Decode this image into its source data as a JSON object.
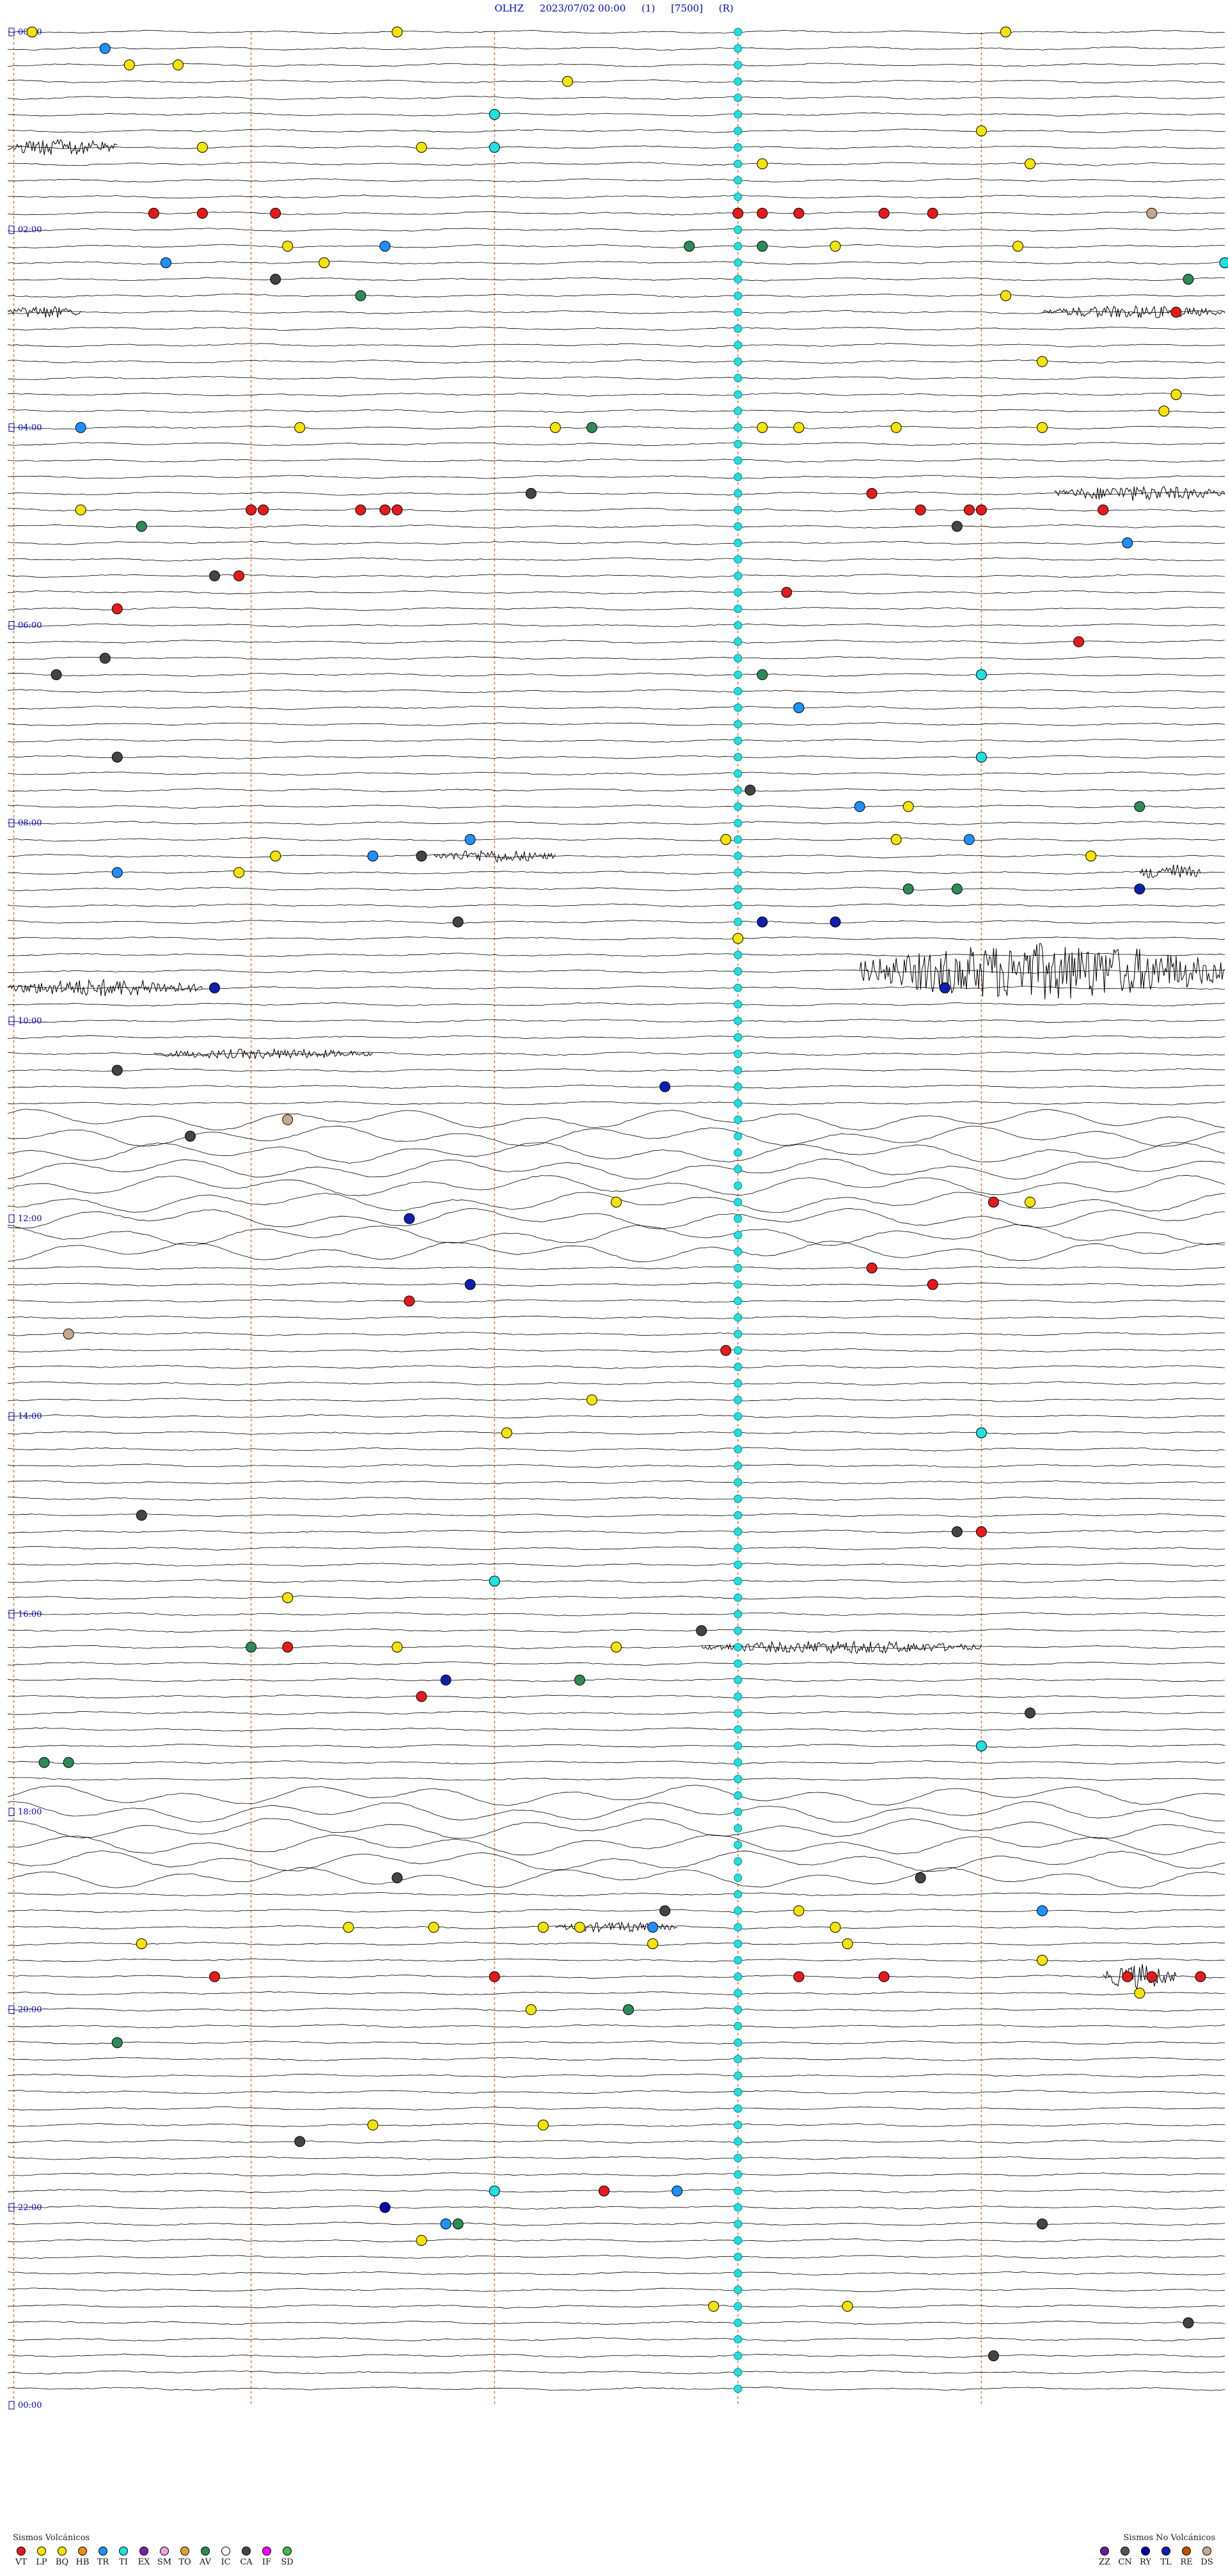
{
  "header": {
    "station": "OLHZ",
    "date_time": "2023/07/02 00:00",
    "channel": "(1)",
    "scale": "[7500]",
    "mode": "(R)"
  },
  "chart_data": {
    "type": "helicorder",
    "title": "OLHZ 2023/07/02 00:00 (1) [7500] (R)",
    "hour_labels": [
      "00:00",
      "02:00",
      "04:00",
      "06:00",
      "08:00",
      "10:00",
      "12:00",
      "14:00",
      "16:00",
      "18:00",
      "20:00",
      "22:00",
      "00:00"
    ],
    "hours": [
      0,
      2,
      4,
      6,
      8,
      10,
      12,
      14,
      16,
      18,
      20,
      22,
      24
    ],
    "trace_count": 144,
    "minutes_per_trace": 10,
    "trace_color": "#000000",
    "label_color": "#0000cc",
    "dashed_marker_color": "#e07a3c",
    "dashed_marker_positions": [
      0.005,
      0.2,
      0.4,
      0.6,
      0.8
    ],
    "cyan_ti_column": 0.6,
    "noisy_trace_ranges": [
      [
        66,
        74
      ],
      [
        107,
        112
      ]
    ],
    "burst_traces": [
      {
        "trace": 7,
        "x0": 0.0,
        "x1": 0.09,
        "amp": 14
      },
      {
        "trace": 17,
        "x0": 0.0,
        "x1": 0.06,
        "amp": 10
      },
      {
        "trace": 17,
        "x0": 0.85,
        "x1": 1.0,
        "amp": 10
      },
      {
        "trace": 28,
        "x0": 0.86,
        "x1": 1.0,
        "amp": 12
      },
      {
        "trace": 50,
        "x0": 0.35,
        "x1": 0.45,
        "amp": 10
      },
      {
        "trace": 51,
        "x0": 0.93,
        "x1": 0.98,
        "amp": 14
      },
      {
        "trace": 57,
        "x0": 0.7,
        "x1": 1.0,
        "amp": 45
      },
      {
        "trace": 58,
        "x0": 0.0,
        "x1": 0.16,
        "amp": 14
      },
      {
        "trace": 62,
        "x0": 0.12,
        "x1": 0.3,
        "amp": 8
      },
      {
        "trace": 98,
        "x0": 0.57,
        "x1": 0.8,
        "amp": 10
      },
      {
        "trace": 115,
        "x0": 0.45,
        "x1": 0.55,
        "amp": 8
      },
      {
        "trace": 118,
        "x0": 0.9,
        "x1": 0.96,
        "amp": 20
      }
    ],
    "event_types": [
      {
        "code": "VT",
        "color": "#e41a1c"
      },
      {
        "code": "LP",
        "color": "#f5e400"
      },
      {
        "code": "BQ",
        "color": "#f5e400"
      },
      {
        "code": "HB",
        "color": "#f08a1e"
      },
      {
        "code": "TR",
        "color": "#1e90ff"
      },
      {
        "code": "TI",
        "color": "#20e0e0"
      },
      {
        "code": "EX",
        "color": "#7b1fa2"
      },
      {
        "code": "SM",
        "color": "#f0a0e0"
      },
      {
        "code": "TO",
        "color": "#e0a030"
      },
      {
        "code": "AV",
        "color": "#2e8b57"
      },
      {
        "code": "IC",
        "color": "#ffffff"
      },
      {
        "code": "CA",
        "color": "#444444"
      },
      {
        "code": "IF",
        "color": "#ff00ff"
      },
      {
        "code": "SD",
        "color": "#44bb44"
      }
    ],
    "non_volcanic_types": [
      {
        "code": "ZZ",
        "color": "#6a1b9a"
      },
      {
        "code": "CN",
        "color": "#555555"
      },
      {
        "code": "RY",
        "color": "#0000aa"
      },
      {
        "code": "TL",
        "color": "#0d1fb0"
      },
      {
        "code": "RE",
        "color": "#c05000"
      },
      {
        "code": "DS",
        "color": "#c8a88a"
      }
    ],
    "events": [
      {
        "trace": 0,
        "x": 0.02,
        "type": "LP"
      },
      {
        "trace": 0,
        "x": 0.32,
        "type": "LP"
      },
      {
        "trace": 0,
        "x": 0.82,
        "type": "LP"
      },
      {
        "trace": 1,
        "x": 0.08,
        "type": "TR"
      },
      {
        "trace": 2,
        "x": 0.1,
        "type": "LP"
      },
      {
        "trace": 2,
        "x": 0.14,
        "type": "LP"
      },
      {
        "trace": 3,
        "x": 0.46,
        "type": "LP"
      },
      {
        "trace": 5,
        "x": 0.4,
        "type": "TI"
      },
      {
        "trace": 6,
        "x": 0.8,
        "type": "LP"
      },
      {
        "trace": 7,
        "x": 0.16,
        "type": "LP"
      },
      {
        "trace": 7,
        "x": 0.34,
        "type": "LP"
      },
      {
        "trace": 7,
        "x": 0.4,
        "type": "TI"
      },
      {
        "trace": 8,
        "x": 0.62,
        "type": "LP"
      },
      {
        "trace": 8,
        "x": 0.84,
        "type": "LP"
      },
      {
        "trace": 11,
        "x": 0.12,
        "type": "VT"
      },
      {
        "trace": 11,
        "x": 0.16,
        "type": "VT"
      },
      {
        "trace": 11,
        "x": 0.22,
        "type": "VT"
      },
      {
        "trace": 11,
        "x": 0.6,
        "type": "VT"
      },
      {
        "trace": 11,
        "x": 0.62,
        "type": "VT"
      },
      {
        "trace": 11,
        "x": 0.65,
        "type": "VT"
      },
      {
        "trace": 11,
        "x": 0.72,
        "type": "VT"
      },
      {
        "trace": 11,
        "x": 0.76,
        "type": "VT"
      },
      {
        "trace": 11,
        "x": 0.94,
        "type": "DS"
      },
      {
        "trace": 13,
        "x": 0.23,
        "type": "LP"
      },
      {
        "trace": 13,
        "x": 0.31,
        "type": "TR"
      },
      {
        "trace": 13,
        "x": 0.56,
        "type": "AV"
      },
      {
        "trace": 13,
        "x": 0.62,
        "type": "AV"
      },
      {
        "trace": 13,
        "x": 0.68,
        "type": "LP"
      },
      {
        "trace": 13,
        "x": 0.83,
        "type": "LP"
      },
      {
        "trace": 14,
        "x": 0.13,
        "type": "TR"
      },
      {
        "trace": 14,
        "x": 0.26,
        "type": "LP"
      },
      {
        "trace": 14,
        "x": 1.0,
        "type": "TI"
      },
      {
        "trace": 15,
        "x": 0.22,
        "type": "CA"
      },
      {
        "trace": 15,
        "x": 0.97,
        "type": "AV"
      },
      {
        "trace": 16,
        "x": 0.29,
        "type": "AV"
      },
      {
        "trace": 16,
        "x": 0.82,
        "type": "LP"
      },
      {
        "trace": 17,
        "x": 0.96,
        "type": "VT"
      },
      {
        "trace": 20,
        "x": 0.85,
        "type": "LP"
      },
      {
        "trace": 22,
        "x": 0.96,
        "type": "LP"
      },
      {
        "trace": 23,
        "x": 0.95,
        "type": "LP"
      },
      {
        "trace": 24,
        "x": 0.06,
        "type": "TR"
      },
      {
        "trace": 24,
        "x": 0.24,
        "type": "LP"
      },
      {
        "trace": 24,
        "x": 0.45,
        "type": "LP"
      },
      {
        "trace": 24,
        "x": 0.48,
        "type": "AV"
      },
      {
        "trace": 24,
        "x": 0.62,
        "type": "LP"
      },
      {
        "trace": 24,
        "x": 0.65,
        "type": "LP"
      },
      {
        "trace": 24,
        "x": 0.73,
        "type": "LP"
      },
      {
        "trace": 24,
        "x": 0.85,
        "type": "LP"
      },
      {
        "trace": 28,
        "x": 0.43,
        "type": "CA"
      },
      {
        "trace": 28,
        "x": 0.71,
        "type": "VT"
      },
      {
        "trace": 29,
        "x": 0.06,
        "type": "LP"
      },
      {
        "trace": 29,
        "x": 0.2,
        "type": "VT"
      },
      {
        "trace": 29,
        "x": 0.21,
        "type": "VT"
      },
      {
        "trace": 29,
        "x": 0.29,
        "type": "VT"
      },
      {
        "trace": 29,
        "x": 0.31,
        "type": "VT"
      },
      {
        "trace": 29,
        "x": 0.32,
        "type": "VT"
      },
      {
        "trace": 29,
        "x": 0.75,
        "type": "VT"
      },
      {
        "trace": 29,
        "x": 0.79,
        "type": "VT"
      },
      {
        "trace": 29,
        "x": 0.8,
        "type": "VT"
      },
      {
        "trace": 29,
        "x": 0.9,
        "type": "VT"
      },
      {
        "trace": 30,
        "x": 0.11,
        "type": "AV"
      },
      {
        "trace": 30,
        "x": 0.78,
        "type": "CA"
      },
      {
        "trace": 31,
        "x": 0.92,
        "type": "TR"
      },
      {
        "trace": 33,
        "x": 0.17,
        "type": "CA"
      },
      {
        "trace": 33,
        "x": 0.19,
        "type": "VT"
      },
      {
        "trace": 34,
        "x": 0.64,
        "type": "VT"
      },
      {
        "trace": 35,
        "x": 0.09,
        "type": "VT"
      },
      {
        "trace": 37,
        "x": 0.88,
        "type": "VT"
      },
      {
        "trace": 38,
        "x": 0.08,
        "type": "CA"
      },
      {
        "trace": 39,
        "x": 0.04,
        "type": "CA"
      },
      {
        "trace": 39,
        "x": 0.62,
        "type": "AV"
      },
      {
        "trace": 39,
        "x": 0.8,
        "type": "TI"
      },
      {
        "trace": 41,
        "x": 0.65,
        "type": "TR"
      },
      {
        "trace": 44,
        "x": 0.09,
        "type": "CA"
      },
      {
        "trace": 44,
        "x": 0.8,
        "type": "TI"
      },
      {
        "trace": 46,
        "x": 0.61,
        "type": "CA"
      },
      {
        "trace": 47,
        "x": 0.74,
        "type": "LP"
      },
      {
        "trace": 47,
        "x": 0.93,
        "type": "AV"
      },
      {
        "trace": 47,
        "x": 0.7,
        "type": "TR"
      },
      {
        "trace": 49,
        "x": 0.38,
        "type": "TR"
      },
      {
        "trace": 49,
        "x": 0.59,
        "type": "LP"
      },
      {
        "trace": 49,
        "x": 0.73,
        "type": "LP"
      },
      {
        "trace": 49,
        "x": 0.79,
        "type": "TR"
      },
      {
        "trace": 50,
        "x": 0.22,
        "type": "LP"
      },
      {
        "trace": 50,
        "x": 0.3,
        "type": "TR"
      },
      {
        "trace": 50,
        "x": 0.34,
        "type": "CA"
      },
      {
        "trace": 50,
        "x": 0.89,
        "type": "LP"
      },
      {
        "trace": 51,
        "x": 0.09,
        "type": "TR"
      },
      {
        "trace": 51,
        "x": 0.19,
        "type": "LP"
      },
      {
        "trace": 52,
        "x": 0.74,
        "type": "AV"
      },
      {
        "trace": 52,
        "x": 0.78,
        "type": "AV"
      },
      {
        "trace": 52,
        "x": 0.93,
        "type": "TL"
      },
      {
        "trace": 54,
        "x": 0.37,
        "type": "CA"
      },
      {
        "trace": 54,
        "x": 0.62,
        "type": "TL"
      },
      {
        "trace": 54,
        "x": 0.68,
        "type": "TL"
      },
      {
        "trace": 55,
        "x": 0.6,
        "type": "LP"
      },
      {
        "trace": 58,
        "x": 0.17,
        "type": "TL"
      },
      {
        "trace": 58,
        "x": 0.77,
        "type": "TL"
      },
      {
        "trace": 63,
        "x": 0.09,
        "type": "CA"
      },
      {
        "trace": 64,
        "x": 0.54,
        "type": "TL"
      },
      {
        "trace": 66,
        "x": 0.23,
        "type": "DS"
      },
      {
        "trace": 67,
        "x": 0.15,
        "type": "CA"
      },
      {
        "trace": 71,
        "x": 0.5,
        "type": "LP"
      },
      {
        "trace": 71,
        "x": 0.81,
        "type": "VT"
      },
      {
        "trace": 71,
        "x": 0.84,
        "type": "LP"
      },
      {
        "trace": 72,
        "x": 0.33,
        "type": "TL"
      },
      {
        "trace": 75,
        "x": 0.71,
        "type": "VT"
      },
      {
        "trace": 76,
        "x": 0.38,
        "type": "TL"
      },
      {
        "trace": 76,
        "x": 0.76,
        "type": "VT"
      },
      {
        "trace": 77,
        "x": 0.33,
        "type": "VT"
      },
      {
        "trace": 79,
        "x": 0.05,
        "type": "DS"
      },
      {
        "trace": 80,
        "x": 0.59,
        "type": "VT"
      },
      {
        "trace": 83,
        "x": 0.48,
        "type": "LP"
      },
      {
        "trace": 85,
        "x": 0.41,
        "type": "LP"
      },
      {
        "trace": 85,
        "x": 0.8,
        "type": "TI"
      },
      {
        "trace": 90,
        "x": 0.11,
        "type": "CA"
      },
      {
        "trace": 91,
        "x": 0.78,
        "type": "CA"
      },
      {
        "trace": 91,
        "x": 0.8,
        "type": "VT"
      },
      {
        "trace": 94,
        "x": 0.4,
        "type": "TI"
      },
      {
        "trace": 95,
        "x": 0.23,
        "type": "LP"
      },
      {
        "trace": 97,
        "x": 0.57,
        "type": "CA"
      },
      {
        "trace": 98,
        "x": 0.2,
        "type": "AV"
      },
      {
        "trace": 98,
        "x": 0.23,
        "type": "VT"
      },
      {
        "trace": 98,
        "x": 0.32,
        "type": "LP"
      },
      {
        "trace": 98,
        "x": 0.5,
        "type": "LP"
      },
      {
        "trace": 100,
        "x": 0.36,
        "type": "TL"
      },
      {
        "trace": 100,
        "x": 0.47,
        "type": "AV"
      },
      {
        "trace": 101,
        "x": 0.34,
        "type": "VT"
      },
      {
        "trace": 102,
        "x": 0.84,
        "type": "CA"
      },
      {
        "trace": 104,
        "x": 0.8,
        "type": "TI"
      },
      {
        "trace": 105,
        "x": 0.03,
        "type": "AV"
      },
      {
        "trace": 105,
        "x": 0.05,
        "type": "AV"
      },
      {
        "trace": 112,
        "x": 0.32,
        "type": "CA"
      },
      {
        "trace": 112,
        "x": 0.75,
        "type": "CA"
      },
      {
        "trace": 114,
        "x": 0.54,
        "type": "CA"
      },
      {
        "trace": 114,
        "x": 0.65,
        "type": "LP"
      },
      {
        "trace": 114,
        "x": 0.85,
        "type": "TR"
      },
      {
        "trace": 115,
        "x": 0.28,
        "type": "LP"
      },
      {
        "trace": 115,
        "x": 0.35,
        "type": "LP"
      },
      {
        "trace": 115,
        "x": 0.44,
        "type": "LP"
      },
      {
        "trace": 115,
        "x": 0.47,
        "type": "LP"
      },
      {
        "trace": 115,
        "x": 0.53,
        "type": "TR"
      },
      {
        "trace": 115,
        "x": 0.68,
        "type": "LP"
      },
      {
        "trace": 116,
        "x": 0.11,
        "type": "LP"
      },
      {
        "trace": 116,
        "x": 0.53,
        "type": "LP"
      },
      {
        "trace": 116,
        "x": 0.69,
        "type": "LP"
      },
      {
        "trace": 117,
        "x": 0.85,
        "type": "LP"
      },
      {
        "trace": 118,
        "x": 0.17,
        "type": "VT"
      },
      {
        "trace": 118,
        "x": 0.65,
        "type": "VT"
      },
      {
        "trace": 118,
        "x": 0.72,
        "type": "VT"
      },
      {
        "trace": 118,
        "x": 0.92,
        "type": "VT"
      },
      {
        "trace": 118,
        "x": 0.94,
        "type": "VT"
      },
      {
        "trace": 118,
        "x": 0.98,
        "type": "VT"
      },
      {
        "trace": 118,
        "x": 0.4,
        "type": "VT"
      },
      {
        "trace": 119,
        "x": 0.93,
        "type": "LP"
      },
      {
        "trace": 120,
        "x": 0.43,
        "type": "LP"
      },
      {
        "trace": 120,
        "x": 0.51,
        "type": "AV"
      },
      {
        "trace": 122,
        "x": 0.09,
        "type": "AV"
      },
      {
        "trace": 127,
        "x": 0.3,
        "type": "LP"
      },
      {
        "trace": 127,
        "x": 0.44,
        "type": "LP"
      },
      {
        "trace": 128,
        "x": 0.24,
        "type": "CA"
      },
      {
        "trace": 131,
        "x": 0.4,
        "type": "TI"
      },
      {
        "trace": 131,
        "x": 0.49,
        "type": "VT"
      },
      {
        "trace": 131,
        "x": 0.55,
        "type": "TR"
      },
      {
        "trace": 132,
        "x": 0.31,
        "type": "RY"
      },
      {
        "trace": 133,
        "x": 0.36,
        "type": "TR"
      },
      {
        "trace": 133,
        "x": 0.37,
        "type": "AV"
      },
      {
        "trace": 133,
        "x": 0.85,
        "type": "CA"
      },
      {
        "trace": 134,
        "x": 0.34,
        "type": "LP"
      },
      {
        "trace": 138,
        "x": 0.58,
        "type": "LP"
      },
      {
        "trace": 138,
        "x": 0.69,
        "type": "LP"
      },
      {
        "trace": 139,
        "x": 0.97,
        "type": "CA"
      },
      {
        "trace": 141,
        "x": 0.81,
        "type": "CA"
      }
    ]
  },
  "legend": {
    "volcanic_title": "Sismos Volcánicos",
    "non_volcanic_title": "Sismos No Volcánicos"
  }
}
